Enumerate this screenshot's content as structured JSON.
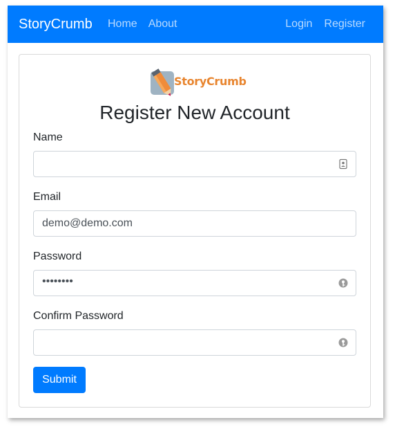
{
  "navbar": {
    "brand": "StoryCrumb",
    "left_links": [
      "Home",
      "About"
    ],
    "right_links": [
      "Login",
      "Register"
    ],
    "background": "#007bff"
  },
  "logo": {
    "text": "StoryCrumb",
    "icon": "pencil-logo-icon",
    "text_color": "#e8852f"
  },
  "form": {
    "title": "Register New Account",
    "fields": [
      {
        "label": "Name",
        "value": "",
        "icon": "contact-card-icon"
      },
      {
        "label": "Email",
        "value": "demo@demo.com",
        "icon": ""
      },
      {
        "label": "Password",
        "value": "••••••••",
        "icon": "password-key-icon"
      },
      {
        "label": "Confirm Password",
        "value": "",
        "icon": "password-key-icon"
      }
    ],
    "submit_label": "Submit",
    "accent": "#007bff"
  }
}
